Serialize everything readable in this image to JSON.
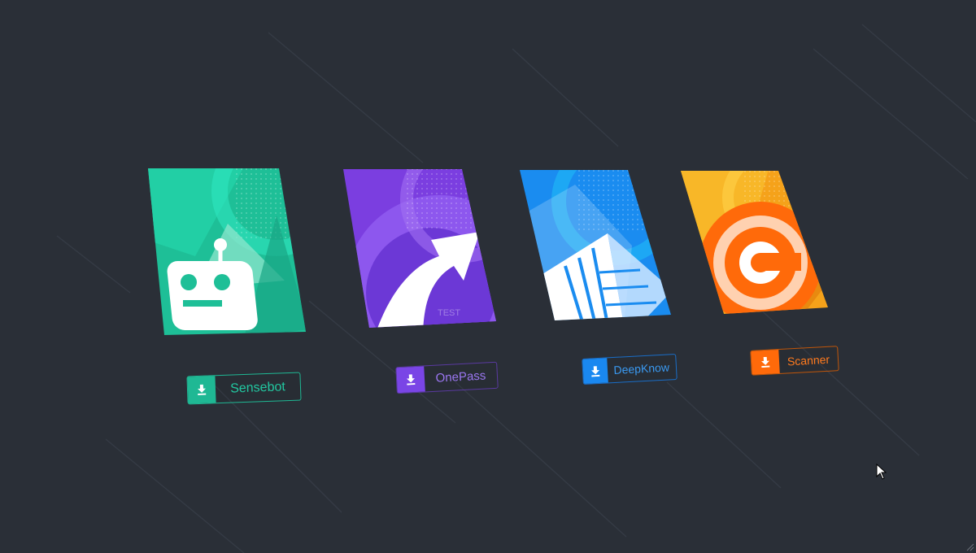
{
  "apps": [
    {
      "name": "Sensebot",
      "icon": "robot-icon",
      "color": "#1fb894"
    },
    {
      "name": "OnePass",
      "icon": "arrow-up-right-icon",
      "color": "#7a45e6"
    },
    {
      "name": "DeepKnow",
      "icon": "pyramid-icon",
      "color": "#1a88f0"
    },
    {
      "name": "Scanner",
      "icon": "spiral-icon",
      "color": "#ff6a0a"
    }
  ],
  "card_watermark": "TEST"
}
